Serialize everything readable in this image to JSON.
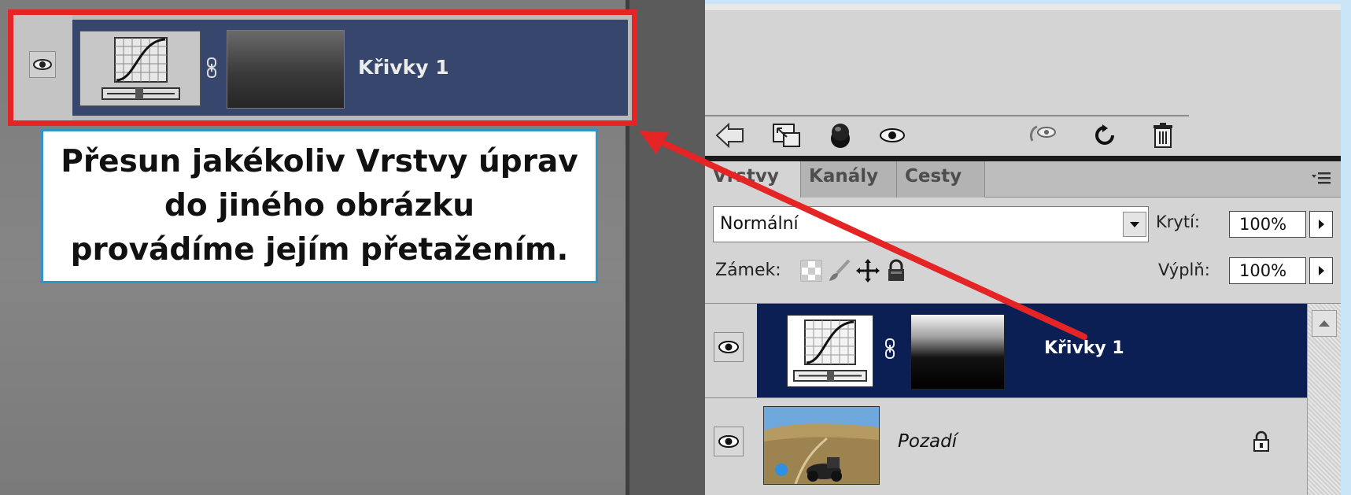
{
  "callout": {
    "line1": "Přesun jakékoliv Vrstvy úprav",
    "line2": "do jiného obrázku",
    "line3": "provádíme jejím přetažením."
  },
  "dragged_layer": {
    "name": "Křivky 1"
  },
  "panel": {
    "tabs": [
      {
        "label": "Vrstvy",
        "active": true
      },
      {
        "label": "Kanály",
        "active": false
      },
      {
        "label": "Cesty",
        "active": false
      }
    ],
    "blend_mode": "Normální",
    "opacity_label": "Krytí:",
    "opacity_value": "100%",
    "lock_label": "Zámek:",
    "fill_label": "Výplň:",
    "fill_value": "100%",
    "layers": [
      {
        "name": "Křivky 1",
        "selected": true,
        "visible": true
      },
      {
        "name": "Pozadí",
        "selected": false,
        "visible": true,
        "locked": true
      }
    ]
  },
  "colors": {
    "highlight_border": "#e52525",
    "callout_border": "#2f95c5",
    "selected_layer": "#0b1f55",
    "page_background": "#c9e4f6"
  },
  "icons": {
    "toolbar": [
      "link-layers-icon",
      "layer-style-icon",
      "layer-mask-icon",
      "adjustment-layer-icon",
      "new-layer-icon",
      "reset-icon",
      "delete-layer-icon"
    ],
    "lock": [
      "lock-transparency-icon",
      "lock-image-icon",
      "lock-position-icon",
      "lock-all-icon"
    ]
  }
}
